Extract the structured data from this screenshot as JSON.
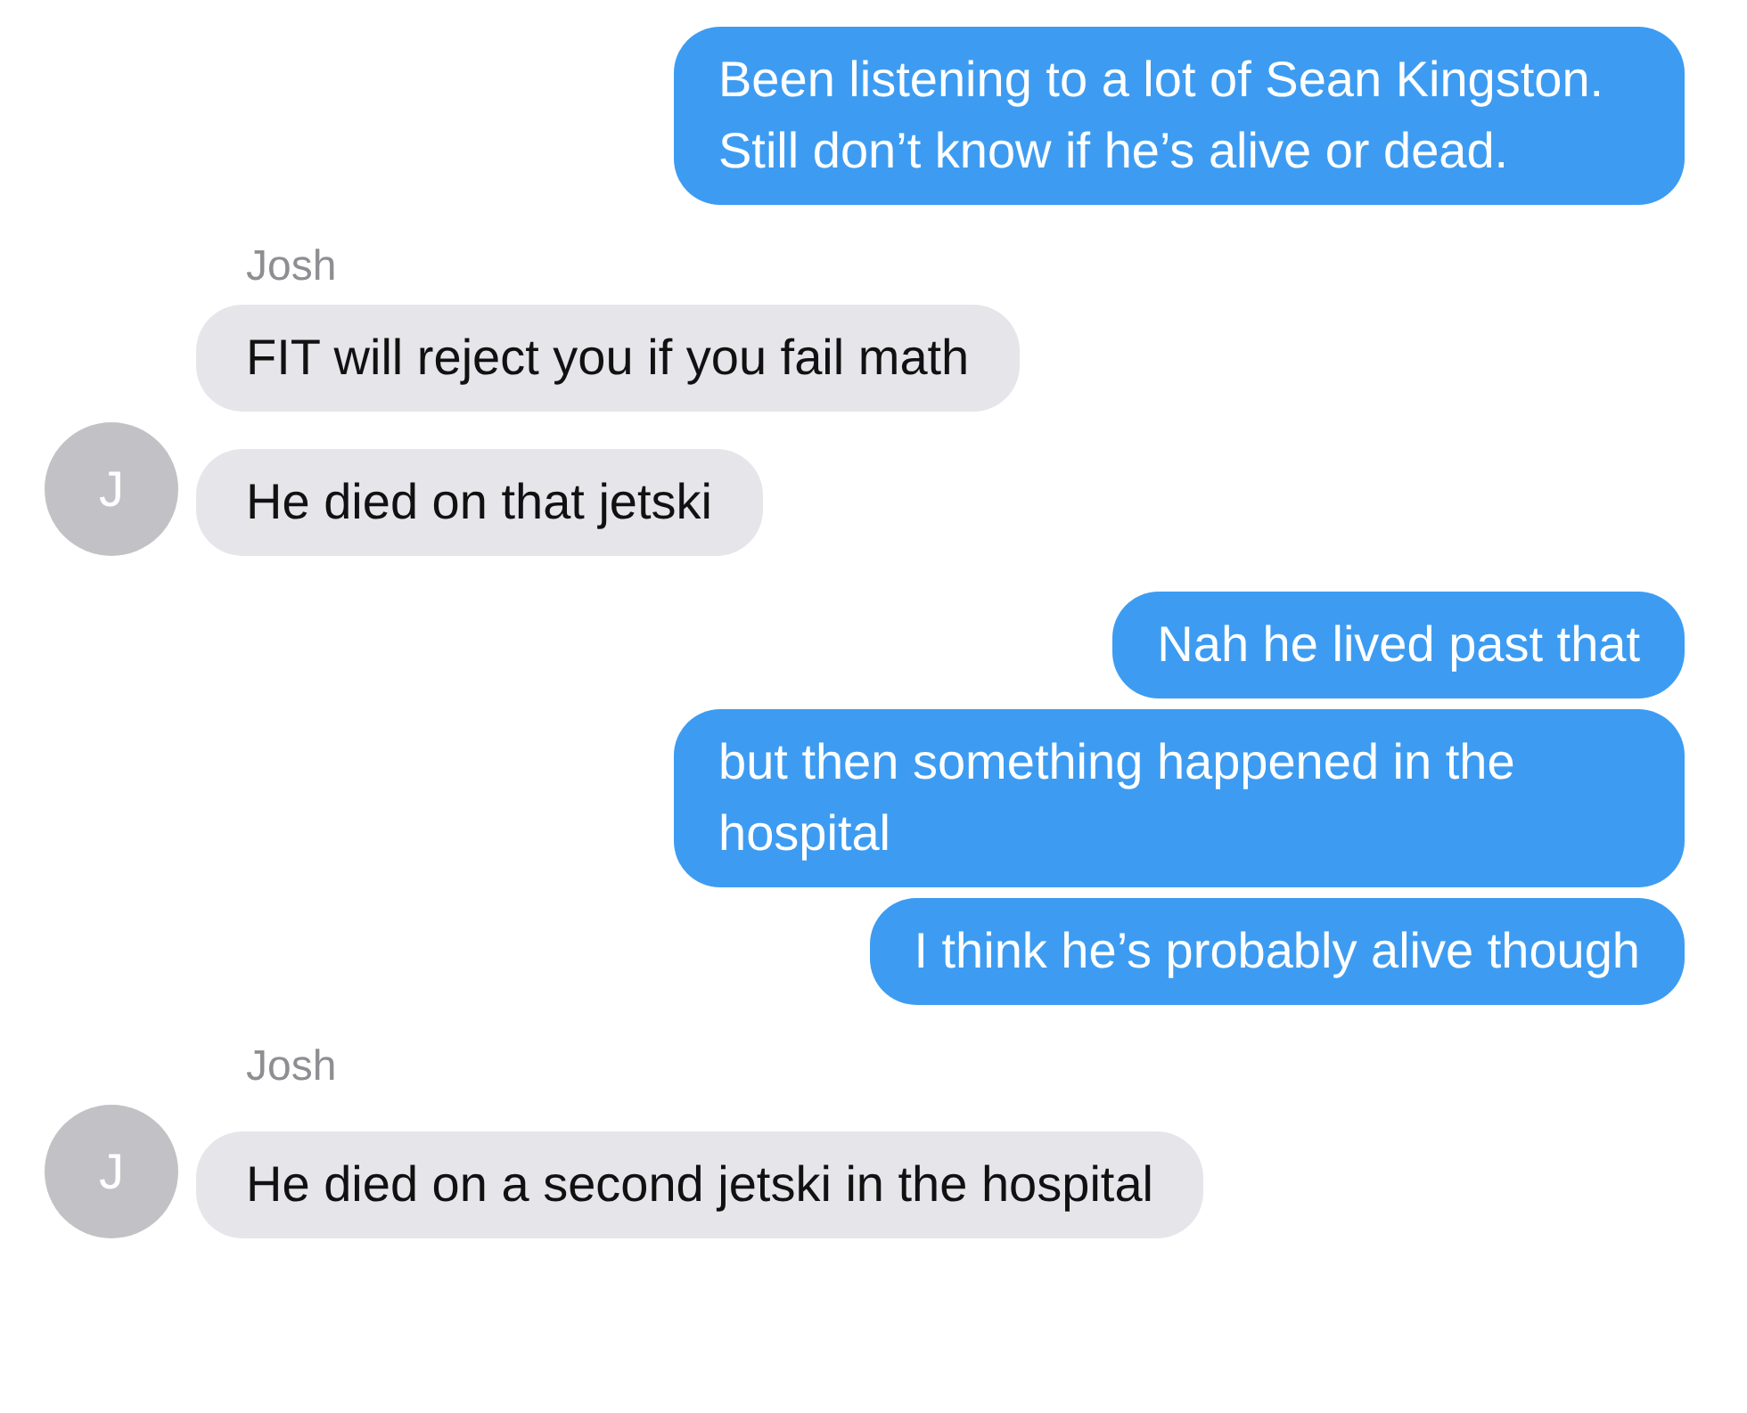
{
  "groups": [
    {
      "kind": "sent",
      "bubbles": [
        "Been listening to a lot of Sean Kingston. Still don’t know if he’s alive or dead."
      ]
    },
    {
      "kind": "received",
      "sender": "Josh",
      "avatar": "J",
      "bubbles": [
        "FIT will reject you if you fail math",
        "He died on that jetski"
      ]
    },
    {
      "kind": "sent",
      "bubbles": [
        "Nah he lived past that",
        "but then something happened in the hospital",
        "I think he’s probably alive though"
      ]
    },
    {
      "kind": "received",
      "sender": "Josh",
      "avatar": "J",
      "bubbles": [
        "He died on a second jetski in the hospital"
      ]
    }
  ]
}
